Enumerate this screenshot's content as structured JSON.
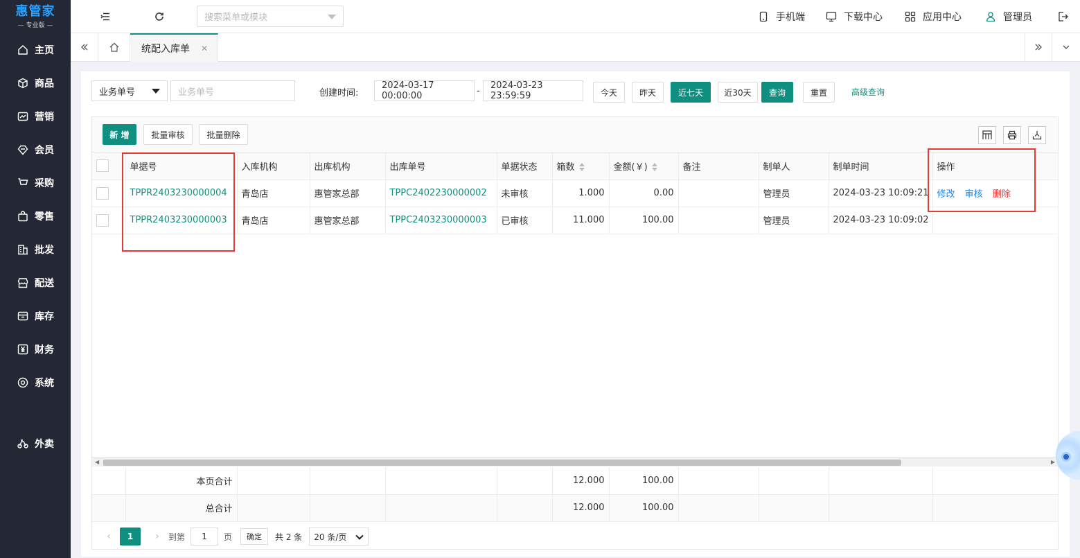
{
  "logo": {
    "main": "惠管家",
    "sub": "— 专业版 —"
  },
  "sidebar": {
    "items": [
      {
        "label": "主页",
        "icon": "home-icon"
      },
      {
        "label": "商品",
        "icon": "box-icon"
      },
      {
        "label": "营销",
        "icon": "chart-icon"
      },
      {
        "label": "会员",
        "icon": "diamond-icon"
      },
      {
        "label": "采购",
        "icon": "cart-icon"
      },
      {
        "label": "零售",
        "icon": "bag-icon"
      },
      {
        "label": "批发",
        "icon": "building-icon"
      },
      {
        "label": "配送",
        "icon": "store-icon"
      },
      {
        "label": "库存",
        "icon": "inventory-icon"
      },
      {
        "label": "财务",
        "icon": "yen-icon"
      },
      {
        "label": "系统",
        "icon": "settings-icon"
      },
      {
        "label": "外卖",
        "icon": "bike-icon"
      }
    ]
  },
  "header": {
    "search_placeholder": "搜索菜单或模块",
    "mobile": "手机端",
    "download": "下载中心",
    "apps": "应用中心",
    "user": "管理员"
  },
  "tabs": {
    "active": "统配入库单"
  },
  "filter": {
    "type_select": "业务单号",
    "order_no_placeholder": "业务单号",
    "created_label": "创建时间:",
    "start": "2024-03-17 00:00:00",
    "dash": "-",
    "end": "2024-03-23 23:59:59",
    "today": "今天",
    "yesterday": "昨天",
    "last7": "近七天",
    "last30": "近30天",
    "query": "查询",
    "reset": "重置",
    "advanced": "高级查询"
  },
  "toolbar": {
    "add": "新 增",
    "batch_audit": "批量审核",
    "batch_delete": "批量删除"
  },
  "table": {
    "columns": [
      "单据号",
      "入库机构",
      "出库机构",
      "出库单号",
      "单据状态",
      "箱数",
      "金额(￥)",
      "备注",
      "制单人",
      "制单时间",
      "操作"
    ],
    "rows": [
      {
        "no": "TPPR2403230000004",
        "in_org": "青岛店",
        "out_org": "惠管家总部",
        "out_no": "TPPC2402230000002",
        "status": "未审核",
        "boxes": "1.000",
        "amount": "0.00",
        "remark": "",
        "maker": "管理员",
        "time": "2024-03-23 10:09:21",
        "ops": [
          "修改",
          "审核",
          "删除"
        ]
      },
      {
        "no": "TPPR2403230000003",
        "in_org": "青岛店",
        "out_org": "惠管家总部",
        "out_no": "TPPC2403230000003",
        "status": "已审核",
        "boxes": "11.000",
        "amount": "100.00",
        "remark": "",
        "maker": "管理员",
        "time": "2024-03-23 10:09:02",
        "ops": []
      }
    ]
  },
  "totals": {
    "page_label": "本页合计",
    "page_boxes": "12.000",
    "page_amount": "100.00",
    "all_label": "总合计",
    "all_boxes": "12.000",
    "all_amount": "100.00"
  },
  "pager": {
    "current": "1",
    "goto": "到第",
    "page_input": "1",
    "page_unit": "页",
    "ok": "确定",
    "total": "共 2 条",
    "size": "20 条/页"
  },
  "colors": {
    "accent": "#0f8f7f",
    "sidebar_bg": "#232834",
    "link_blue": "#1e88e5",
    "danger": "#e53935"
  }
}
